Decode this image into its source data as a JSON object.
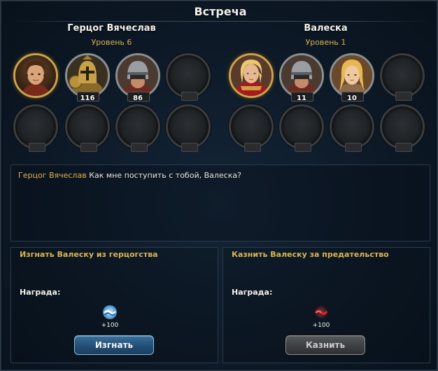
{
  "window": {
    "title": "Встреча"
  },
  "left_side": {
    "name": "Герцог Вячеслав",
    "level": "Уровень 6",
    "slots": [
      {
        "kind": "hero",
        "portrait": "young-man-portrait",
        "count": ""
      },
      {
        "kind": "unit",
        "portrait": "gold-armored-knight-portrait",
        "count": "116"
      },
      {
        "kind": "unit",
        "portrait": "helmeted-soldier-portrait",
        "count": "86"
      },
      {
        "kind": "empty",
        "count": ""
      }
    ]
  },
  "right_side": {
    "name": "Валеска",
    "level": "Уровень 1",
    "slots": [
      {
        "kind": "hero",
        "portrait": "blonde-woman-red-armor-portrait",
        "count": ""
      },
      {
        "kind": "unit",
        "portrait": "helmeted-soldier-portrait",
        "count": "11"
      },
      {
        "kind": "unit",
        "portrait": "blonde-maiden-portrait",
        "count": "10"
      },
      {
        "kind": "empty",
        "count": ""
      }
    ]
  },
  "dialog": {
    "speaker": "Герцог Вячеслав",
    "text": "Как мне поступить с тобой, Валеска?"
  },
  "choices": [
    {
      "title": "Изгнать Валеску из герцогства",
      "reward_label": "Награда:",
      "reward_icon": "blue-swirl-icon",
      "reward_amount": "+100",
      "button_label": "Изгнать",
      "button_state": "active"
    },
    {
      "title": "Казнить Валеску за предательство",
      "reward_label": "Награда:",
      "reward_icon": "red-swirl-icon",
      "reward_amount": "+100",
      "button_label": "Казнить",
      "button_state": "disabled"
    }
  ],
  "colors": {
    "accent_gold": "#d9b451",
    "button_blue": "#24527a",
    "button_gray": "#3f4245"
  }
}
